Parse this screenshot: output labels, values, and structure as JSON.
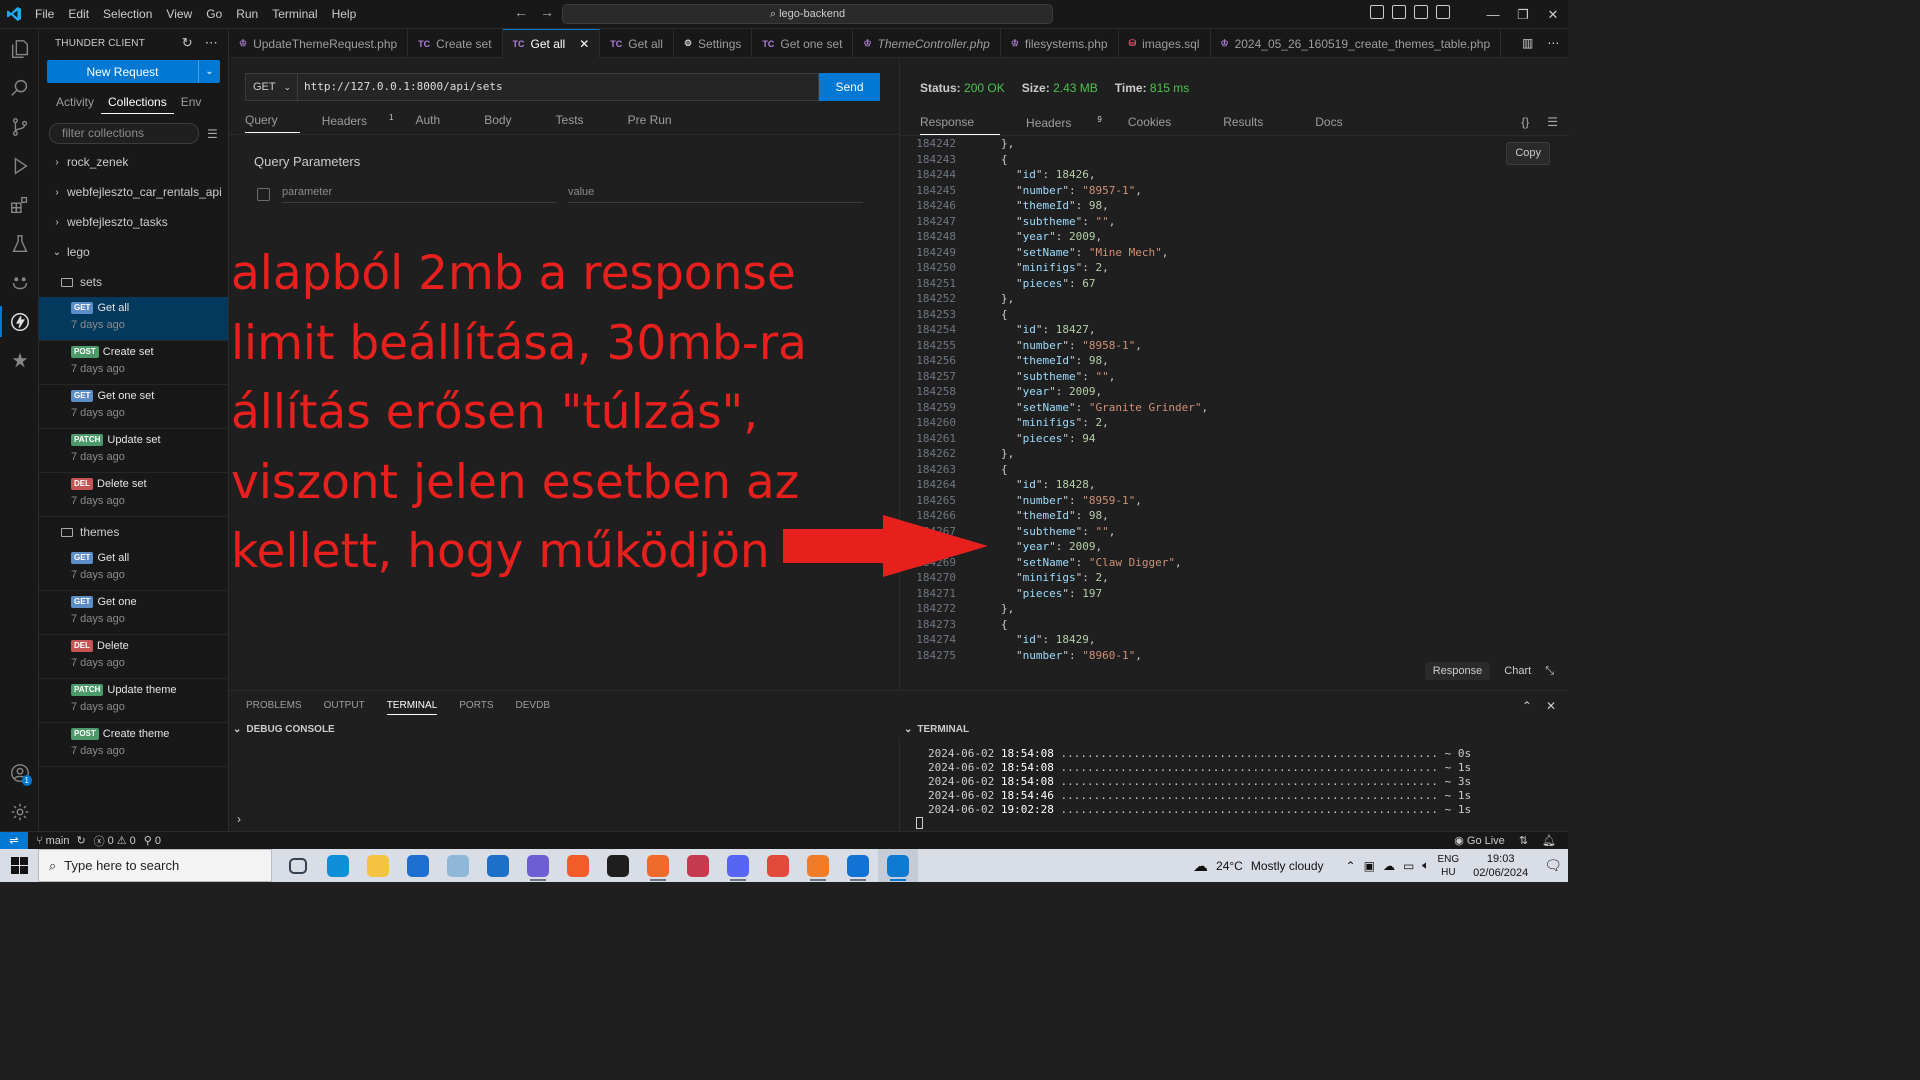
{
  "titlebar": {
    "menu": [
      "File",
      "Edit",
      "Selection",
      "View",
      "Go",
      "Run",
      "Terminal",
      "Help"
    ],
    "search": "lego-backend"
  },
  "sidebar": {
    "title": "THUNDER CLIENT",
    "new_request": "New Request",
    "tabs": [
      "Activity",
      "Collections",
      "Env"
    ],
    "filter_placeholder": "filter collections",
    "collections": [
      "rock_zenek",
      "webfejleszto_car_rentals_api",
      "webfejleszto_tasks",
      "lego"
    ],
    "folder_sets": "sets",
    "folder_themes": "themes",
    "sets_requests": [
      {
        "method": "GET",
        "name": "Get all",
        "time": "7 days ago"
      },
      {
        "method": "POST",
        "name": "Create set",
        "time": "7 days ago"
      },
      {
        "method": "GET",
        "name": "Get one set",
        "time": "7 days ago"
      },
      {
        "method": "PATCH",
        "name": "Update set",
        "time": "7 days ago"
      },
      {
        "method": "DEL",
        "name": "Delete set",
        "time": "7 days ago"
      }
    ],
    "themes_requests": [
      {
        "method": "GET",
        "name": "Get all",
        "time": "7 days ago"
      },
      {
        "method": "GET",
        "name": "Get one",
        "time": "7 days ago"
      },
      {
        "method": "DEL",
        "name": "Delete",
        "time": "7 days ago"
      },
      {
        "method": "PATCH",
        "name": "Update theme",
        "time": "7 days ago"
      },
      {
        "method": "POST",
        "name": "Create theme",
        "time": "7 days ago"
      }
    ]
  },
  "tabs": [
    {
      "icon": "php",
      "label": "UpdateThemeRequest.php"
    },
    {
      "icon": "TC",
      "label": "Create set"
    },
    {
      "icon": "TC",
      "label": "Get all",
      "active": true
    },
    {
      "icon": "TC",
      "label": "Get all"
    },
    {
      "icon": "gear",
      "label": "Settings"
    },
    {
      "icon": "TC",
      "label": "Get one set"
    },
    {
      "icon": "php",
      "label": "ThemeController.php"
    },
    {
      "icon": "php",
      "label": "filesystems.php"
    },
    {
      "icon": "db",
      "label": "images.sql"
    },
    {
      "icon": "php",
      "label": "2024_05_26_160519_create_themes_table.php"
    }
  ],
  "request": {
    "method": "GET",
    "url": "http://127.0.0.1:8000/api/sets",
    "send": "Send",
    "tabs": [
      "Query",
      "Headers",
      "Auth",
      "Body",
      "Tests",
      "Pre Run"
    ],
    "headers_count": "1",
    "query_title": "Query Parameters",
    "param_placeholder": "parameter",
    "value_placeholder": "value"
  },
  "annotation": "alapból 2mb a response limit beállítása, 30mb-ra állítás erősen \"túlzás\", viszont jelen esetben az kellett, hogy működjön",
  "response": {
    "status_label": "Status:",
    "status": "200 OK",
    "size_label": "Size:",
    "size": "2.43 MB",
    "time_label": "Time:",
    "time": "815 ms",
    "tabs": [
      "Response",
      "Headers",
      "Cookies",
      "Results",
      "Docs"
    ],
    "headers_count": "9",
    "copy": "Copy",
    "footer": [
      "Response",
      "Chart"
    ],
    "lines": [
      {
        "n": "184242",
        "t": "},"
      },
      {
        "n": "184243",
        "t": "{"
      },
      {
        "n": "184244",
        "k": "id",
        "v": "18426",
        "vt": "n"
      },
      {
        "n": "184245",
        "k": "number",
        "v": "\"8957-1\"",
        "vt": "s"
      },
      {
        "n": "184246",
        "k": "themeId",
        "v": "98",
        "vt": "n"
      },
      {
        "n": "184247",
        "k": "subtheme",
        "v": "\"\"",
        "vt": "s"
      },
      {
        "n": "184248",
        "k": "year",
        "v": "2009",
        "vt": "n"
      },
      {
        "n": "184249",
        "k": "setName",
        "v": "\"Mine Mech\"",
        "vt": "s"
      },
      {
        "n": "184250",
        "k": "minifigs",
        "v": "2",
        "vt": "n"
      },
      {
        "n": "184251",
        "k": "pieces",
        "v": "67",
        "vt": "n",
        "last": true
      },
      {
        "n": "184252",
        "t": "},"
      },
      {
        "n": "184253",
        "t": "{"
      },
      {
        "n": "184254",
        "k": "id",
        "v": "18427",
        "vt": "n"
      },
      {
        "n": "184255",
        "k": "number",
        "v": "\"8958-1\"",
        "vt": "s"
      },
      {
        "n": "184256",
        "k": "themeId",
        "v": "98",
        "vt": "n"
      },
      {
        "n": "184257",
        "k": "subtheme",
        "v": "\"\"",
        "vt": "s"
      },
      {
        "n": "184258",
        "k": "year",
        "v": "2009",
        "vt": "n"
      },
      {
        "n": "184259",
        "k": "setName",
        "v": "\"Granite Grinder\"",
        "vt": "s"
      },
      {
        "n": "184260",
        "k": "minifigs",
        "v": "2",
        "vt": "n"
      },
      {
        "n": "184261",
        "k": "pieces",
        "v": "94",
        "vt": "n",
        "last": true
      },
      {
        "n": "184262",
        "t": "},"
      },
      {
        "n": "184263",
        "t": "{"
      },
      {
        "n": "184264",
        "k": "id",
        "v": "18428",
        "vt": "n"
      },
      {
        "n": "184265",
        "k": "number",
        "v": "\"8959-1\"",
        "vt": "s"
      },
      {
        "n": "184266",
        "k": "themeId",
        "v": "98",
        "vt": "n"
      },
      {
        "n": "184267",
        "k": "subtheme",
        "v": "\"\"",
        "vt": "s"
      },
      {
        "n": "184268",
        "k": "year",
        "v": "2009",
        "vt": "n"
      },
      {
        "n": "184269",
        "k": "setName",
        "v": "\"Claw Digger\"",
        "vt": "s"
      },
      {
        "n": "184270",
        "k": "minifigs",
        "v": "2",
        "vt": "n"
      },
      {
        "n": "184271",
        "k": "pieces",
        "v": "197",
        "vt": "n",
        "last": true
      },
      {
        "n": "184272",
        "t": "},"
      },
      {
        "n": "184273",
        "t": "{"
      },
      {
        "n": "184274",
        "k": "id",
        "v": "18429",
        "vt": "n"
      },
      {
        "n": "184275",
        "k": "number",
        "v": "\"8960-1\"",
        "vt": "s"
      }
    ]
  },
  "panel": {
    "tabs": [
      "PROBLEMS",
      "OUTPUT",
      "TERMINAL",
      "PORTS",
      "DEVDB"
    ],
    "debug_console": "DEBUG CONSOLE",
    "terminal": "TERMINAL",
    "terminal_lines": [
      {
        "date": "2024-06-02",
        "time": "18:54:08",
        "dur": "~ 0s"
      },
      {
        "date": "2024-06-02",
        "time": "18:54:08",
        "dur": "~ 1s"
      },
      {
        "date": "2024-06-02",
        "time": "18:54:08",
        "dur": "~ 3s"
      },
      {
        "date": "2024-06-02",
        "time": "18:54:46",
        "dur": "~ 1s"
      },
      {
        "date": "2024-06-02",
        "time": "19:02:28",
        "dur": "~ 1s"
      }
    ]
  },
  "statusbar": {
    "branch": "main",
    "errors": "0",
    "warnings": "0",
    "ports": "0",
    "golive": "Go Live"
  },
  "taskbar": {
    "search": "Type here to search",
    "weather_temp": "24°C",
    "weather_desc": "Mostly cloudy",
    "lang1": "ENG",
    "lang2": "HU",
    "time": "19:03",
    "date": "02/06/2024",
    "apps": [
      {
        "name": "task-view",
        "color": "#374151"
      },
      {
        "name": "edge",
        "color": "#0f8fd8"
      },
      {
        "name": "file-explorer",
        "color": "#f5c342"
      },
      {
        "name": "store",
        "color": "#1f6fd1"
      },
      {
        "name": "app",
        "color": "#8fb8d8"
      },
      {
        "name": "mail",
        "color": "#1e6fc8"
      },
      {
        "name": "app",
        "color": "#6d5fd3"
      },
      {
        "name": "brave",
        "color": "#f25b2a"
      },
      {
        "name": "7zip",
        "color": "#1f1f1f"
      },
      {
        "name": "firefox",
        "color": "#f06a2b"
      },
      {
        "name": "app",
        "color": "#c53a4d"
      },
      {
        "name": "discord",
        "color": "#5865f2"
      },
      {
        "name": "chrome",
        "color": "#e04a3a"
      },
      {
        "name": "xampp",
        "color": "#f07c2a"
      },
      {
        "name": "app",
        "color": "#1173d4"
      },
      {
        "name": "vscode",
        "color": "#0f7ad1"
      }
    ]
  }
}
